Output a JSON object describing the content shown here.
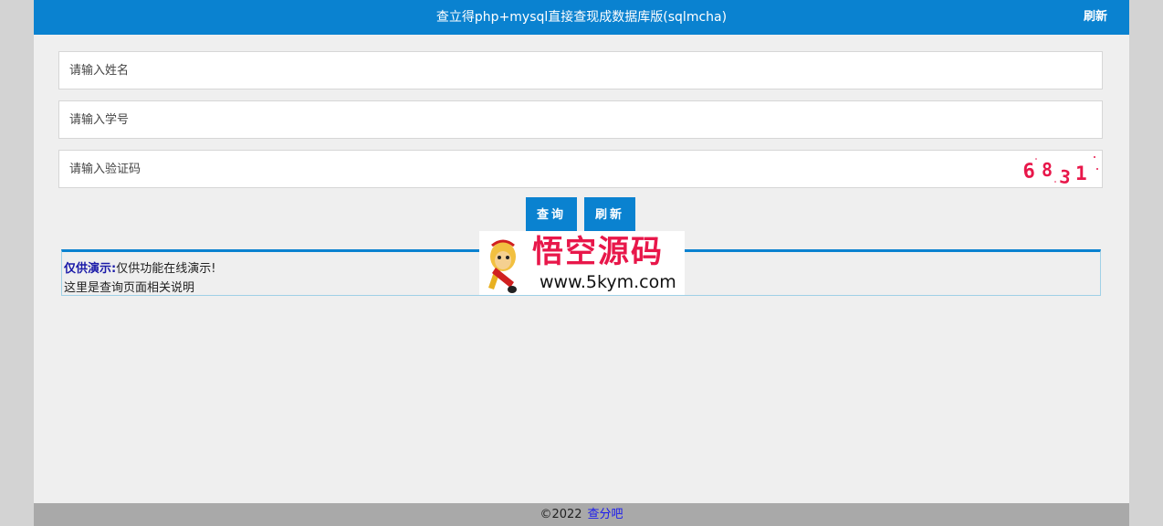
{
  "header": {
    "title": "查立得php+mysql直接查现成数据库版(sqlmcha)",
    "refresh_label": "刷新"
  },
  "form": {
    "name_placeholder": "请输入姓名",
    "id_placeholder": "请输入学号",
    "captcha_placeholder": "请输入验证码",
    "captcha_code": "6831"
  },
  "buttons": {
    "query_label": "查询",
    "refresh_label": "刷新"
  },
  "notice": {
    "label": "仅供演示:",
    "text": "仅供功能在线演示!",
    "description": "这里是查询页面相关说明"
  },
  "watermark": {
    "title": "悟空源码",
    "url": "www.5kym.com"
  },
  "footer": {
    "copyright": "©2022",
    "link_label": "查分吧"
  },
  "colors": {
    "accent": "#0a82d0",
    "captcha": "#e8174a"
  }
}
